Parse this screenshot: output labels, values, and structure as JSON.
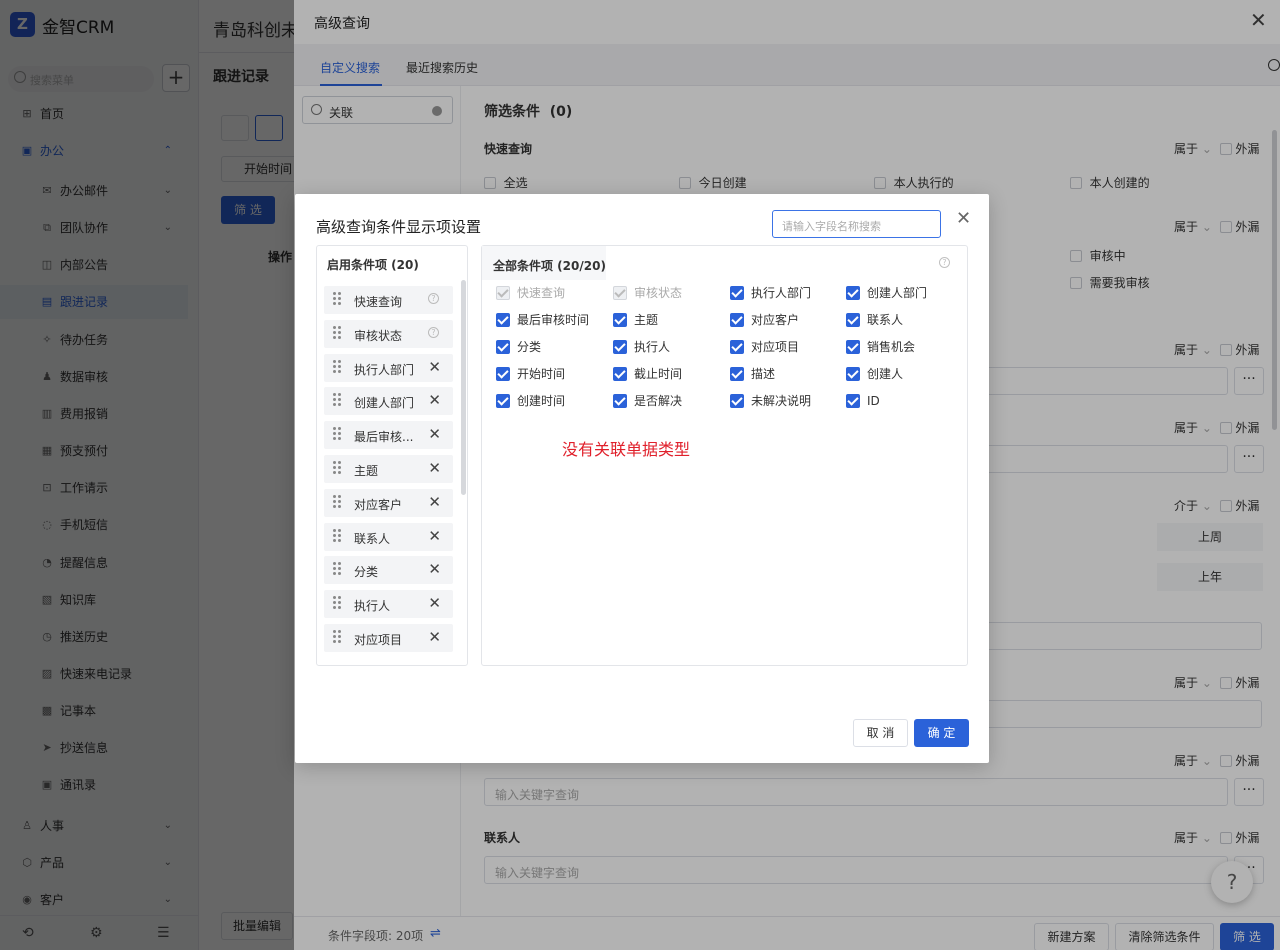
{
  "app": {
    "logo_glyph": "Z",
    "name": "金智CRM",
    "header_title": "青岛科创未来"
  },
  "sidebar": {
    "search_placeholder": "搜索菜单",
    "items": [
      {
        "label": "首页",
        "icon": "grid-icon"
      },
      {
        "label": "办公",
        "icon": "briefcase-icon",
        "expanded": true
      },
      {
        "label": "办公邮件",
        "icon": "mail-icon",
        "expandable": true
      },
      {
        "label": "团队协作",
        "icon": "team-icon",
        "expandable": true
      },
      {
        "label": "内部公告",
        "icon": "announce-icon"
      },
      {
        "label": "跟进记录",
        "icon": "record-icon",
        "active": true
      },
      {
        "label": "待办任务",
        "icon": "pin-icon"
      },
      {
        "label": "数据审核",
        "icon": "audit-icon"
      },
      {
        "label": "费用报销",
        "icon": "receipt-icon"
      },
      {
        "label": "预支预付",
        "icon": "wallet-icon"
      },
      {
        "label": "工作请示",
        "icon": "request-icon"
      },
      {
        "label": "手机短信",
        "icon": "sms-icon"
      },
      {
        "label": "提醒信息",
        "icon": "bell-icon"
      },
      {
        "label": "知识库",
        "icon": "book-icon"
      },
      {
        "label": "推送历史",
        "icon": "clock-icon"
      },
      {
        "label": "快速来电记录",
        "icon": "phone-icon"
      },
      {
        "label": "记事本",
        "icon": "notebook-icon"
      },
      {
        "label": "抄送信息",
        "icon": "send-icon"
      },
      {
        "label": "通讯录",
        "icon": "contacts-icon"
      },
      {
        "label": "人事",
        "icon": "people-icon",
        "expandable": true
      },
      {
        "label": "产品",
        "icon": "product-icon",
        "expandable": true
      },
      {
        "label": "客户",
        "icon": "customer-icon",
        "expandable": true
      }
    ]
  },
  "background_page": {
    "title": "跟进记录",
    "start_time_btn": "开始时间",
    "filter_btn": "筛 选",
    "ops_header": "操作",
    "batch_edit": "批量编辑"
  },
  "drawer": {
    "title": "高级查询",
    "tabs": [
      "自定义搜索",
      "最近搜索历史"
    ],
    "left_search_value": "关联",
    "filter_head": "筛选条件",
    "filter_count": "(0)",
    "sections": {
      "quick_query": "快速查询",
      "contact": "联系人"
    },
    "belongs_label": "属于",
    "between_label": "介于",
    "omit_label": "外漏",
    "quick_options": [
      "全选",
      "今日创建",
      "本人执行的",
      "本人创建的"
    ],
    "audit_options": [
      "审核中",
      "需要我审核"
    ],
    "date_chips": [
      "上周",
      "上年"
    ],
    "keyword_placeholder": "输入关键字查询",
    "footer_text": "条件字段项:  20项",
    "btn_new_plan": "新建方案",
    "btn_clear": "清除筛选条件",
    "btn_filter": "筛 选",
    "help": "?"
  },
  "modal": {
    "title": "高级查询条件显示项设置",
    "search_placeholder": "请输入字段名称搜索",
    "enabled_header": "启用条件项 (20)",
    "enabled_items": [
      {
        "label": "快速查询",
        "locked": true
      },
      {
        "label": "审核状态",
        "locked": true
      },
      {
        "label": "执行人部门",
        "locked": false
      },
      {
        "label": "创建人部门",
        "locked": false
      },
      {
        "label": "最后审核...",
        "locked": false
      },
      {
        "label": "主题",
        "locked": false
      },
      {
        "label": "对应客户",
        "locked": false
      },
      {
        "label": "联系人",
        "locked": false
      },
      {
        "label": "分类",
        "locked": false
      },
      {
        "label": "执行人",
        "locked": false
      },
      {
        "label": "对应项目",
        "locked": false
      }
    ],
    "all_header": "全部条件项 (20/20)",
    "all_items": [
      {
        "label": "快速查询",
        "disabled": true
      },
      {
        "label": "审核状态",
        "disabled": true
      },
      {
        "label": "执行人部门"
      },
      {
        "label": "创建人部门"
      },
      {
        "label": "最后审核时间"
      },
      {
        "label": "主题"
      },
      {
        "label": "对应客户"
      },
      {
        "label": "联系人"
      },
      {
        "label": "分类"
      },
      {
        "label": "执行人"
      },
      {
        "label": "对应项目"
      },
      {
        "label": "销售机会"
      },
      {
        "label": "开始时间"
      },
      {
        "label": "截止时间"
      },
      {
        "label": "描述"
      },
      {
        "label": "创建人"
      },
      {
        "label": "创建时间"
      },
      {
        "label": "是否解决"
      },
      {
        "label": "未解决说明"
      },
      {
        "label": "ID"
      }
    ],
    "annotation": "没有关联单据类型",
    "cancel": "取 消",
    "ok": "确 定"
  },
  "colors": {
    "primary": "#2b62d9",
    "annotation": "#e0202b"
  }
}
